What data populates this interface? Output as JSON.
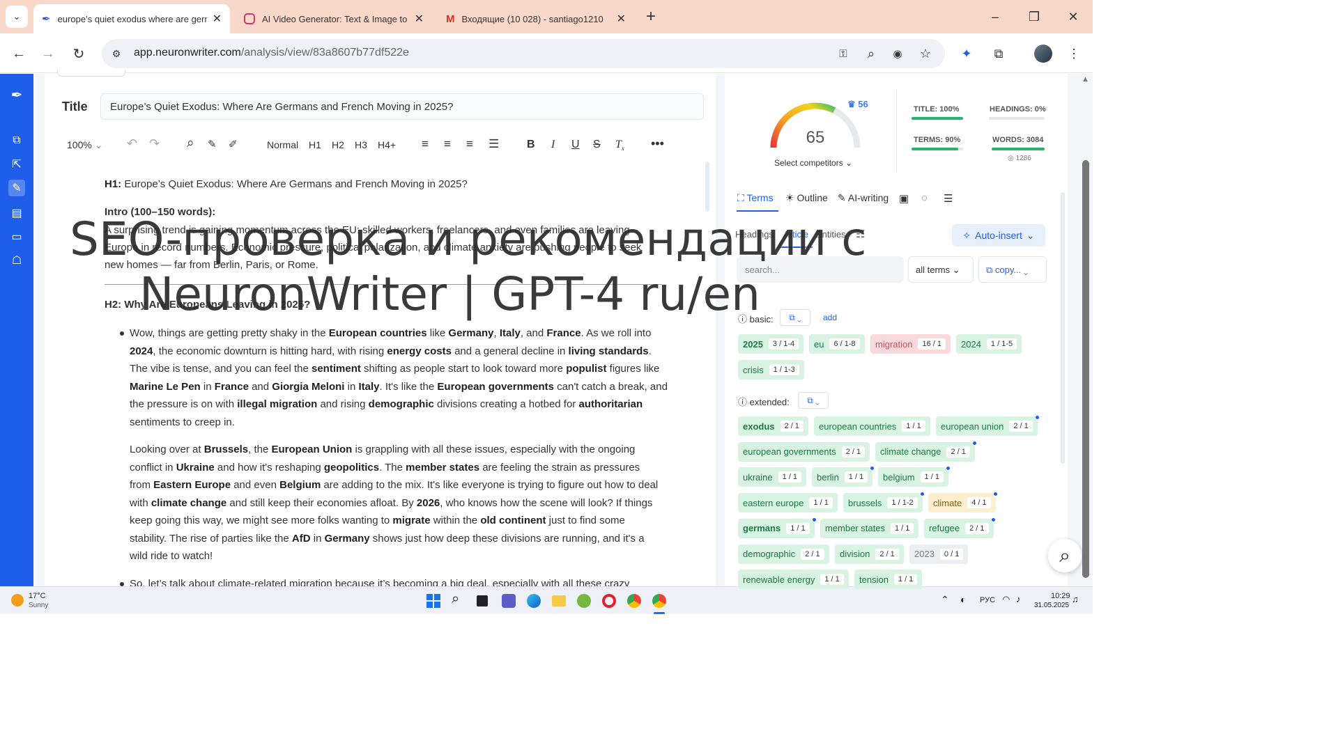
{
  "browser": {
    "tabs": [
      {
        "title": "europe’s quiet exodus where are germans",
        "icon": "feather-icon",
        "active": true
      },
      {
        "title": "AI Video Generator: Text & Image to Video",
        "icon": "instagram-icon",
        "active": false
      },
      {
        "title": "Входящие (10 028) - santiago1210",
        "icon": "gmail-icon",
        "active": false
      }
    ],
    "new_tab": "+",
    "url_host": "app.neuronwriter.com",
    "url_path": "/analysis/view/83a8607b77df522e"
  },
  "editor": {
    "title_label": "Title",
    "title_value": "Europe’s Quiet Exodus: Where Are Germans and French Moving in 2025?",
    "toolbar": {
      "zoom": "100%",
      "normal": "Normal",
      "h1": "H1",
      "h2": "H2",
      "h3": "H3",
      "h4": "H4+"
    },
    "h1_label": "H1:",
    "h1_text": "Europe’s Quiet Exodus: Where Are Germans and French Moving in 2025?",
    "intro_label": "Intro (100–150 words):",
    "intro_lines": [
      "A surprising trend is gaining momentum across the EU: skilled workers, freelancers, and even families are leaving",
      "Europe in record numbers. Economic pressure, political polarization, and climate anxiety are pushing people to seek",
      "new homes — far from Berlin, Paris, or Rome."
    ],
    "h2": "H2: Why Are Europeans Leaving in 2025?",
    "bottom_line": "So, let’s talk about climate-related migration because it’s becoming a big deal, especially with all these crazy"
  },
  "overlay": {
    "line1": "SEO-проверка и рекомендации с",
    "line2": "NeuronWriter | GPT-4 ru/en"
  },
  "score": {
    "value": "65",
    "competitors_score": "56",
    "select_competitors": "Select competitors",
    "gauge_fraction": 0.65
  },
  "metrics": {
    "title": {
      "label": "TITLE: 100%",
      "pct": 100
    },
    "headings": {
      "label": "HEADINGS: 0%",
      "pct": 0
    },
    "terms": {
      "label": "TERMS: 90%",
      "pct": 90
    },
    "words": {
      "label": "WORDS: 3084",
      "pct": 100,
      "sub": "1286"
    }
  },
  "panel": {
    "tabs": {
      "terms": "Terms",
      "outline": "Outline",
      "ai": "AI-writing"
    },
    "subtabs": {
      "headings": "Headings",
      "article": "Article",
      "entities": "Entities"
    },
    "auto_insert": "Auto-insert",
    "search_placeholder": "search...",
    "filter": "all terms",
    "copy": "copy...",
    "basic_label": "basic:",
    "add": "add",
    "extended_label": "extended:"
  },
  "terms_basic": [
    {
      "t": "2025",
      "c": "3 / 1-4",
      "s": "green",
      "b": true
    },
    {
      "t": "eu",
      "c": "6 / 1-8",
      "s": "green"
    },
    {
      "t": "migration",
      "c": "16 / 1",
      "s": "red"
    },
    {
      "t": "2024",
      "c": "1 / 1-5",
      "s": "green"
    },
    {
      "t": "crisis",
      "c": "1 / 1-3",
      "s": "green"
    }
  ],
  "terms_extended": [
    {
      "t": "exodus",
      "c": "2 / 1",
      "s": "green",
      "b": true
    },
    {
      "t": "european countries",
      "c": "1 / 1",
      "s": "green"
    },
    {
      "t": "european union",
      "c": "2 / 1",
      "s": "green",
      "dot": true
    },
    {
      "t": "european governments",
      "c": "2 / 1",
      "s": "green"
    },
    {
      "t": "climate change",
      "c": "2 / 1",
      "s": "green",
      "dot": true
    },
    {
      "t": "ukraine",
      "c": "1 / 1",
      "s": "green"
    },
    {
      "t": "berlin",
      "c": "1 / 1",
      "s": "green",
      "dot": true
    },
    {
      "t": "belgium",
      "c": "1 / 1",
      "s": "green",
      "dot": true
    },
    {
      "t": "eastern europe",
      "c": "1 / 1",
      "s": "green"
    },
    {
      "t": "brussels",
      "c": "1 / 1-2",
      "s": "green",
      "dot": true
    },
    {
      "t": "climate",
      "c": "4 / 1",
      "s": "yellow",
      "dot": true
    },
    {
      "t": "germans",
      "c": "1 / 1",
      "s": "green",
      "b": true,
      "dot": true
    },
    {
      "t": "member states",
      "c": "1 / 1",
      "s": "green"
    },
    {
      "t": "refugee",
      "c": "2 / 1",
      "s": "green",
      "dot": true
    },
    {
      "t": "demographic",
      "c": "2 / 1",
      "s": "green"
    },
    {
      "t": "division",
      "c": "2 / 1",
      "s": "green"
    },
    {
      "t": "2023",
      "c": "0 / 1",
      "s": "gray"
    },
    {
      "t": "renewable energy",
      "c": "1 / 1",
      "s": "green"
    },
    {
      "t": "tension",
      "c": "1 / 1",
      "s": "green"
    }
  ],
  "taskbar": {
    "temp": "17°C",
    "weather": "Sunny",
    "lang": "РУС",
    "time": "10:29",
    "date": "31.05.2025"
  }
}
